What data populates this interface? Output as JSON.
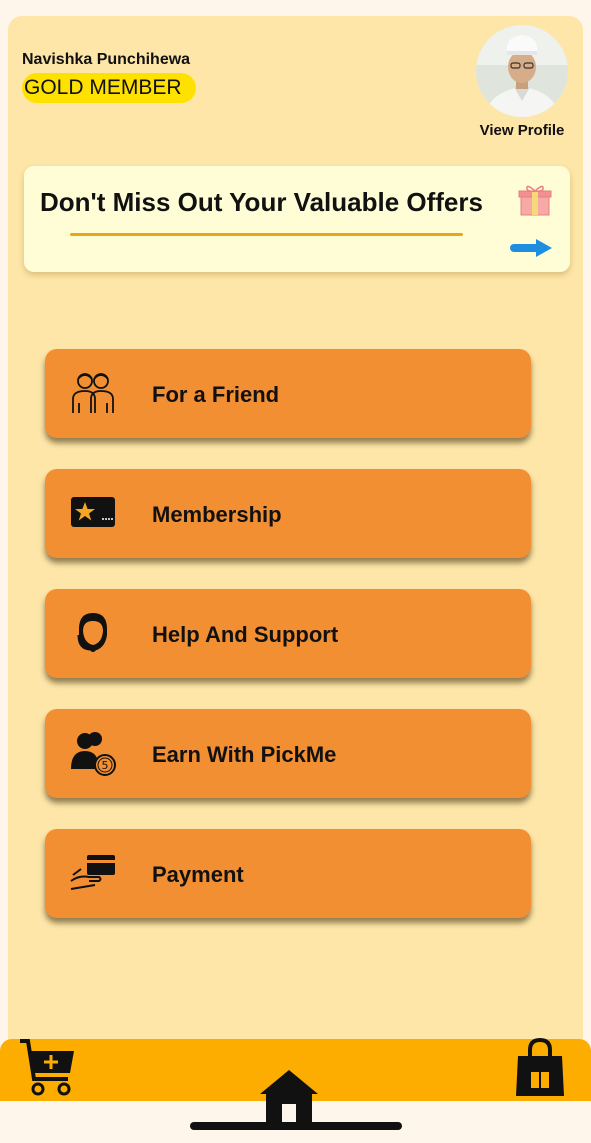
{
  "profile": {
    "name": "Navishka Punchihewa",
    "membership": "GOLD MEMBER",
    "view_profile": "View Profile"
  },
  "offers": {
    "title": "Don't Miss Out Your Valuable Offers",
    "gift_icon": "gift-icon",
    "arrow_icon": "arrow-right-icon"
  },
  "menu": {
    "items": [
      {
        "label": "For a Friend",
        "icon": "friends-icon"
      },
      {
        "label": "Membership",
        "icon": "membership-card-icon"
      },
      {
        "label": "Help And Support",
        "icon": "support-agent-icon"
      },
      {
        "label": "Earn With PickMe",
        "icon": "earn-icon"
      },
      {
        "label": "Payment",
        "icon": "payment-card-icon"
      }
    ]
  },
  "bottom_nav": {
    "left_icon": "add-to-cart-icon",
    "center_icon": "home-icon",
    "right_icon": "shopping-bag-icon"
  },
  "colors": {
    "background": "#fde6a8",
    "badge": "#ffe100",
    "menu_button": "#f28f32",
    "bottom_bar": "#fdac00",
    "offer_card": "#fffdd6"
  }
}
